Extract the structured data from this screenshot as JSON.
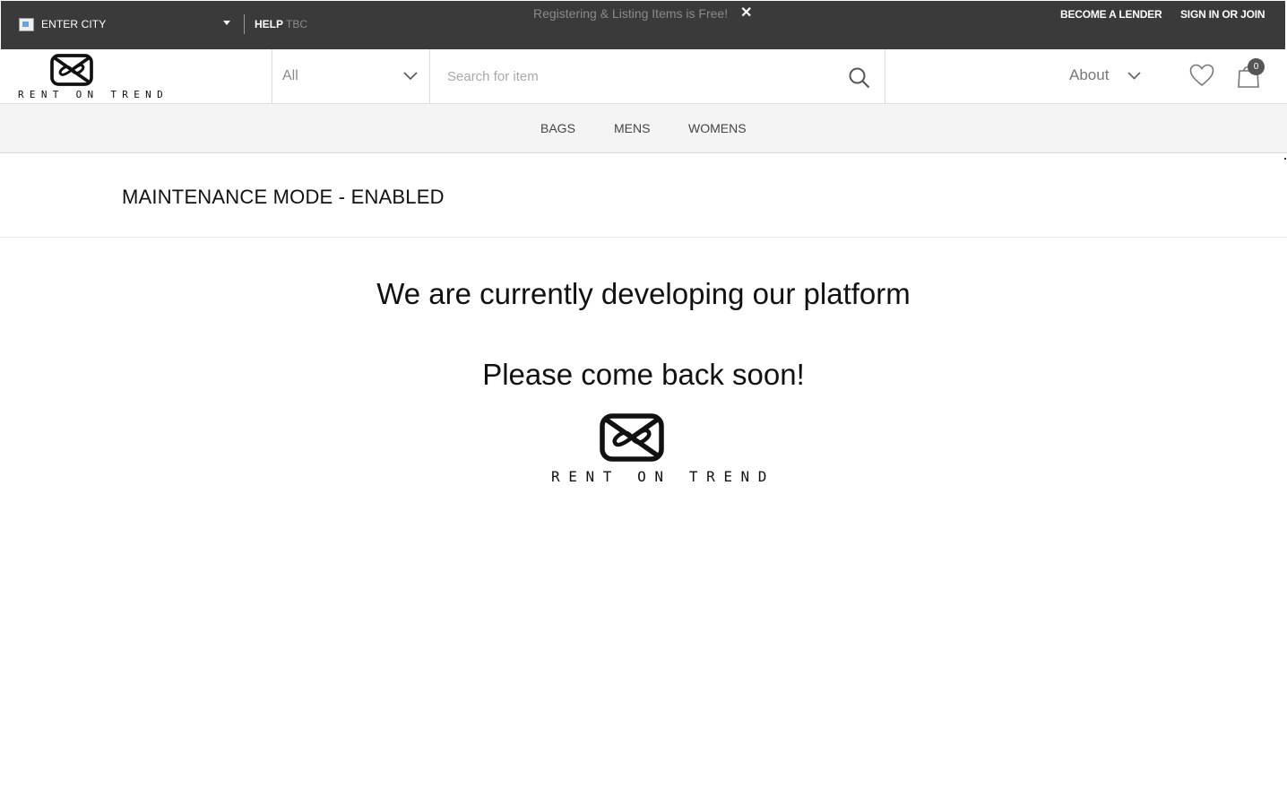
{
  "topbar": {
    "city_label": "ENTER CITY",
    "help_label": "HELP",
    "help_suffix": "TBC",
    "promo_text": "Registering & Listing Items is Free!",
    "close_symbol": "✕",
    "become_lender": "BECOME A LENDER",
    "sign_in": "SIGN IN OR JOIN"
  },
  "header": {
    "logo_text": "RENT ON TREND",
    "category_value": "All",
    "search_placeholder": "Search for item",
    "about_label": "About",
    "cart_count": "0",
    "icons": [
      "flag-icon",
      "caret-down-icon",
      "logo-icon",
      "chevron-down-icon",
      "search-icon",
      "heart-icon",
      "shopping-bag-icon"
    ]
  },
  "nav": {
    "items": [
      "BAGS",
      "MENS",
      "WOMENS"
    ]
  },
  "main": {
    "heading": "MAINTENANCE MODE - ENABLED",
    "message": "We are currently developing our platform",
    "sub_message": "Please come back soon!",
    "logo_text": "RENT ON TREND"
  },
  "colors": {
    "topbar_bg": "#3a3a3a",
    "nav_bg": "#f4f4f4",
    "badge_bg": "#555555"
  }
}
